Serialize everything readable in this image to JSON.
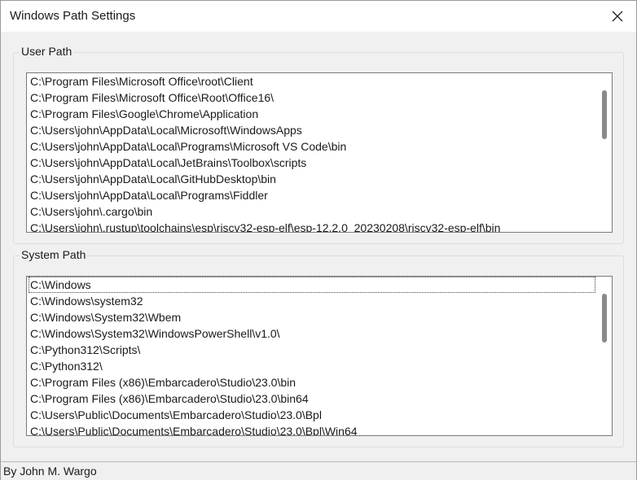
{
  "window": {
    "title": "Windows Path Settings"
  },
  "user_path": {
    "label": "User Path",
    "items": [
      "C:\\Program Files\\Microsoft Office\\root\\Client",
      "C:\\Program Files\\Microsoft Office\\Root\\Office16\\",
      "C:\\Program Files\\Google\\Chrome\\Application",
      "C:\\Users\\john\\AppData\\Local\\Microsoft\\WindowsApps",
      "C:\\Users\\john\\AppData\\Local\\Programs\\Microsoft VS Code\\bin",
      "C:\\Users\\john\\AppData\\Local\\JetBrains\\Toolbox\\scripts",
      "C:\\Users\\john\\AppData\\Local\\GitHubDesktop\\bin",
      "C:\\Users\\john\\AppData\\Local\\Programs\\Fiddler",
      "C:\\Users\\john\\.cargo\\bin",
      "C:\\Users\\john\\.rustup\\toolchains\\esp\\riscv32-esp-elf\\esp-12.2.0_20230208\\riscv32-esp-elf\\bin"
    ]
  },
  "system_path": {
    "label": "System Path",
    "items": [
      "C:\\Windows",
      "C:\\Windows\\system32",
      "C:\\Windows\\System32\\Wbem",
      "C:\\Windows\\System32\\WindowsPowerShell\\v1.0\\",
      "C:\\Python312\\Scripts\\",
      "C:\\Python312\\",
      "C:\\Program Files (x86)\\Embarcadero\\Studio\\23.0\\bin",
      "C:\\Program Files (x86)\\Embarcadero\\Studio\\23.0\\bin64",
      "C:\\Users\\Public\\Documents\\Embarcadero\\Studio\\23.0\\Bpl",
      "C:\\Users\\Public\\Documents\\Embarcadero\\Studio\\23.0\\Bpl\\Win64"
    ]
  },
  "status": {
    "text": "By John M. Wargo"
  },
  "icons": {
    "close": "close-icon"
  }
}
